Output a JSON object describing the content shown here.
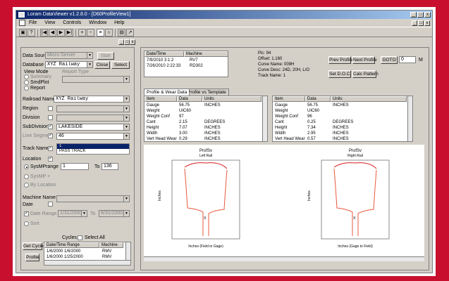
{
  "window": {
    "title": "Loram DataViewer  v1.2.8.0 - [D60ProfileView1]",
    "min": "_",
    "max": "□",
    "close": "x"
  },
  "menu": [
    "File",
    "View",
    "Controls",
    "Window",
    "Help"
  ],
  "toolbar_icons": [
    "save-icon",
    "help-icon",
    "first-icon",
    "prev-icon",
    "next-icon",
    "last-icon",
    "zoom-in-icon",
    "zoom-out-icon",
    "wear-icon",
    "profile-icon",
    "print-icon",
    "export-icon"
  ],
  "left": {
    "data_source_label": "Data Source",
    "data_source_value": "Micro Server",
    "start_label": "Start",
    "database_label": "Database",
    "database_value": "XYZ Railway",
    "close_label": "Close",
    "select_label": "Select",
    "view_mode_label": "View Mode",
    "view_modes": [
      "Summary",
      "SmdPlot",
      "Report"
    ],
    "report_type_label": "Report Type",
    "railroad_name_label": "Railroad Name",
    "railroad_name_value": "XYZ Railway",
    "region_label": "Region",
    "division_label": "Division",
    "subdivision_label": "SubDivision",
    "subdivision_value": "LAKESIDE",
    "line_segment_label": "Line Segment",
    "line_segment_value": "46",
    "track_name_label": "Track Name",
    "track_name_list": [
      "1",
      "PASS TRACK"
    ],
    "location_label": "Location",
    "sys_mp_range_label": "SysMPrange",
    "sys_mp_from": "1",
    "to_label": "To",
    "sys_mp_to": "136",
    "sys_mp_plus_label": "SysMP +",
    "sys_location_label": "By Location",
    "machine_name_label": "Machine Name",
    "date_label": "Date",
    "date_range_label": "Date Range",
    "date_from": "1/31/2000",
    "date_to": "8/31/2000",
    "sort_label": "Sort",
    "cycles_label": "Cycles",
    "select_all_label": "Select All",
    "get_cycles_label": "Get Cycles",
    "profile_label": "Profile",
    "cycle_columns": [
      "Date/Time Range",
      "Machine"
    ],
    "cycles": [
      {
        "range": "1/6/2000 1/6/2000",
        "machine": "RMV"
      },
      {
        "range": "1/6/2000 1/25/2000",
        "machine": "RMV"
      }
    ]
  },
  "session": {
    "columns": [
      "Date/Time",
      "Machine"
    ],
    "rows": [
      {
        "date": "7/9/2010 3:1:2",
        "machine": "RV7"
      },
      {
        "date": "7/26/2010 2:22:33",
        "machine": "RD302"
      }
    ]
  },
  "info": {
    "pic": "Pic: 94",
    "offset": "Offset: 1.160",
    "curve_name": "Curve Name: 009H",
    "curve_desc": "Curve Desc: 24D, 20H, L/O",
    "track_name": "Track Name: 1"
  },
  "actions": {
    "prev_profile": "Prev Profile",
    "next_profile": "Next Profile",
    "goto": "GOTO",
    "goto_value": "0",
    "m_suffix": "M",
    "set_doc": "Set D.O.C.",
    "calc_pattern": "Calc Pattern"
  },
  "tabs": [
    "Profile & Wear Data",
    "Profile vs Template"
  ],
  "table_columns": [
    "Item",
    "Data",
    "Units"
  ],
  "left_rail": [
    {
      "item": "Gauge",
      "data": "56.75",
      "units": "INCHES"
    },
    {
      "item": "Weight",
      "data": "UIC60",
      "units": ""
    },
    {
      "item": "Weight Conf",
      "data": "97",
      "units": ""
    },
    {
      "item": "Cant",
      "data": "2.15",
      "units": "DEGREES"
    },
    {
      "item": "Height",
      "data": "7.07",
      "units": "INCHES"
    },
    {
      "item": "Width",
      "data": "3.00",
      "units": "INCHES"
    },
    {
      "item": "Vert Head Wear",
      "data": "0.29",
      "units": "INCHES"
    }
  ],
  "right_rail": [
    {
      "item": "Gauge",
      "data": "56.75",
      "units": "INCHES"
    },
    {
      "item": "Weight",
      "data": "UIC60",
      "units": ""
    },
    {
      "item": "Weight Conf",
      "data": "96",
      "units": ""
    },
    {
      "item": "Cant",
      "data": "0.25",
      "units": "DEGREES"
    },
    {
      "item": "Height",
      "data": "7.34",
      "units": "INCHES"
    },
    {
      "item": "Width",
      "data": "2.95",
      "units": "INCHES"
    },
    {
      "item": "Vert Head Wear",
      "data": "0.57",
      "units": "INCHES"
    }
  ],
  "charts": [
    {
      "title": "ProfSv",
      "subtitle": "Left Rail",
      "xlabel": "Inches (Field to Gage)",
      "ylabel": "Inches"
    },
    {
      "title": "ProfSv",
      "subtitle": "Right Rail",
      "xlabel": "Inches (Gage to Field)",
      "ylabel": "Inches"
    }
  ],
  "colors": {
    "profile": "#e8583c",
    "template": "#d41c1c",
    "accent": "#0a246a",
    "border": "#c8102e"
  }
}
